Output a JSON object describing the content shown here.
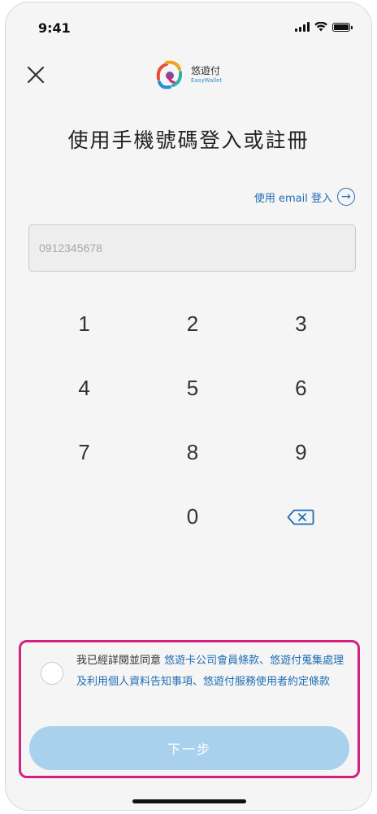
{
  "status_bar": {
    "time": "9:41"
  },
  "header": {
    "logo": {
      "name_cn": "悠遊付",
      "name_en": "EasyWallet"
    },
    "close_icon": "close-icon"
  },
  "title": "使用手機號碼登入或註冊",
  "email_login": {
    "label": "使用 email 登入",
    "icon": "arrow-right-circle-icon"
  },
  "phone_input": {
    "value": "",
    "placeholder": "0912345678"
  },
  "keypad": {
    "keys": [
      "1",
      "2",
      "3",
      "4",
      "5",
      "6",
      "7",
      "8",
      "9",
      "",
      "0",
      "backspace"
    ]
  },
  "agreement": {
    "prefix": "我已經詳閱並同意 ",
    "link1": "悠遊卡公司會員條款",
    "sep1": "、",
    "link2": "悠遊付蒐集處理及利用個人資料告知事項",
    "sep2": "、",
    "link3": "悠遊付服務使用者約定條款",
    "checked": false
  },
  "next_button": {
    "label": "下一步",
    "enabled": false
  },
  "colors": {
    "link": "#1f6db3",
    "highlight_border": "#d4207f",
    "button_disabled": "#a9d1ee",
    "background": "#f5f5f5"
  }
}
